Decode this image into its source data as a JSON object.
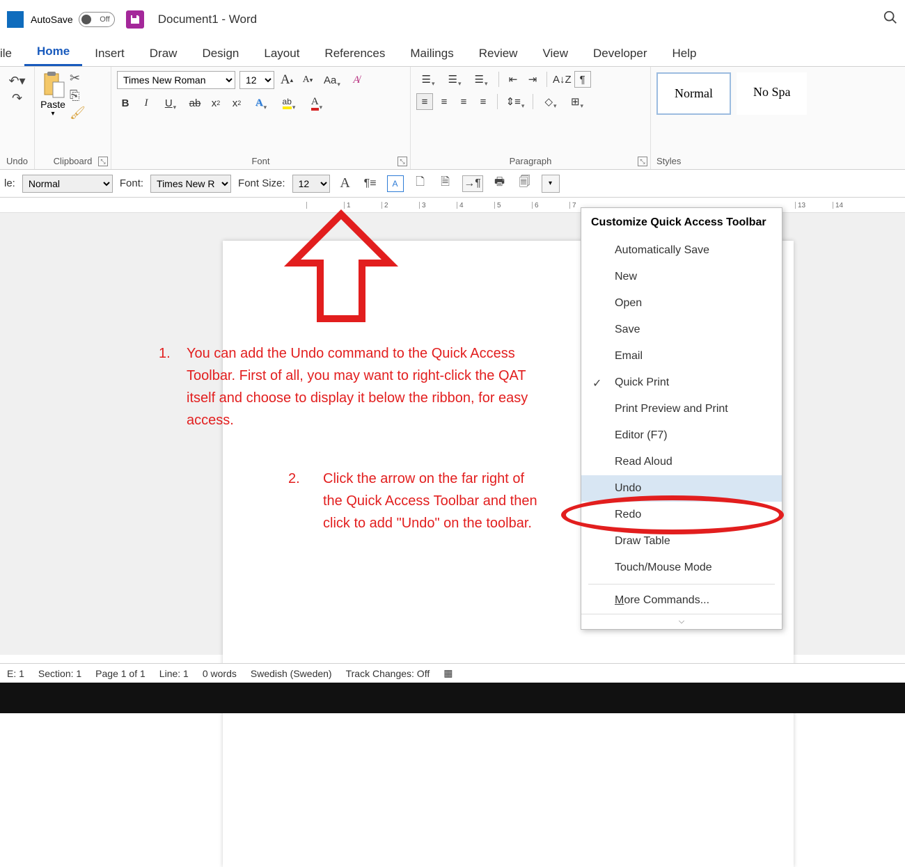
{
  "titlebar": {
    "autosave_label": "AutoSave",
    "toggle_off": "Off",
    "doc_title": "Document1  -  Word"
  },
  "tabs": {
    "file": "ile",
    "home": "Home",
    "insert": "Insert",
    "draw": "Draw",
    "design": "Design",
    "layout": "Layout",
    "references": "References",
    "mailings": "Mailings",
    "review": "Review",
    "view": "View",
    "developer": "Developer",
    "help": "Help"
  },
  "ribbon": {
    "undo_label": "Undo",
    "clipboard": {
      "paste": "Paste",
      "label": "Clipboard"
    },
    "font": {
      "name": "Times New Roman",
      "size": "12",
      "label": "Font",
      "increase": "A",
      "decrease": "A",
      "case": "Aa",
      "bold": "B",
      "italic": "I",
      "underline": "U",
      "strike": "ab",
      "sub": "x",
      "sup": "x",
      "effects": "A",
      "highlight": "▁",
      "color": "A"
    },
    "paragraph": {
      "label": "Paragraph"
    },
    "styles": {
      "normal": "Normal",
      "nospace": "No Spa",
      "label": "Styles"
    }
  },
  "qat_row": {
    "style_label": "le:",
    "style_value": "Normal",
    "font_label": "Font:",
    "font_value": "Times New R",
    "size_label": "Font Size:",
    "size_value": "12"
  },
  "ruler": {
    "marks": [
      "1",
      "2",
      "3",
      "4",
      "5",
      "6",
      "7",
      "13",
      "14"
    ]
  },
  "instructions": {
    "n1": "1.",
    "t1": "You can add the Undo command to the Quick Access Toolbar. First of all, you may want to right-click the QAT itself and choose to display it below the ribbon, for easy access.",
    "n2": "2.",
    "t2": "Click the arrow on the far right of the Quick Access Toolbar and then click to add \"Undo\" on the toolbar."
  },
  "dropdown": {
    "header": "Customize Quick Access Toolbar",
    "items": [
      {
        "label": "Automatically Save",
        "checked": false
      },
      {
        "label": "New",
        "checked": false
      },
      {
        "label": "Open",
        "checked": false
      },
      {
        "label": "Save",
        "checked": false
      },
      {
        "label": "Email",
        "checked": false
      },
      {
        "label": "Quick Print",
        "checked": true
      },
      {
        "label": "Print Preview and Print",
        "checked": false
      },
      {
        "label": "Editor (F7)",
        "checked": false
      },
      {
        "label": "Read Aloud",
        "checked": false
      },
      {
        "label": "Undo",
        "checked": false,
        "hover": true
      },
      {
        "label": "Redo",
        "checked": false
      },
      {
        "label": "Draw Table",
        "checked": false
      },
      {
        "label": "Touch/Mouse Mode",
        "checked": false
      }
    ],
    "more": "ore Commands...",
    "more_accel": "M"
  },
  "statusbar": {
    "page_e": "E: 1",
    "section": "Section: 1",
    "page": "Page 1 of 1",
    "line": "Line: 1",
    "words": "0 words",
    "lang": "Swedish (Sweden)",
    "track": "Track Changes: Off"
  }
}
